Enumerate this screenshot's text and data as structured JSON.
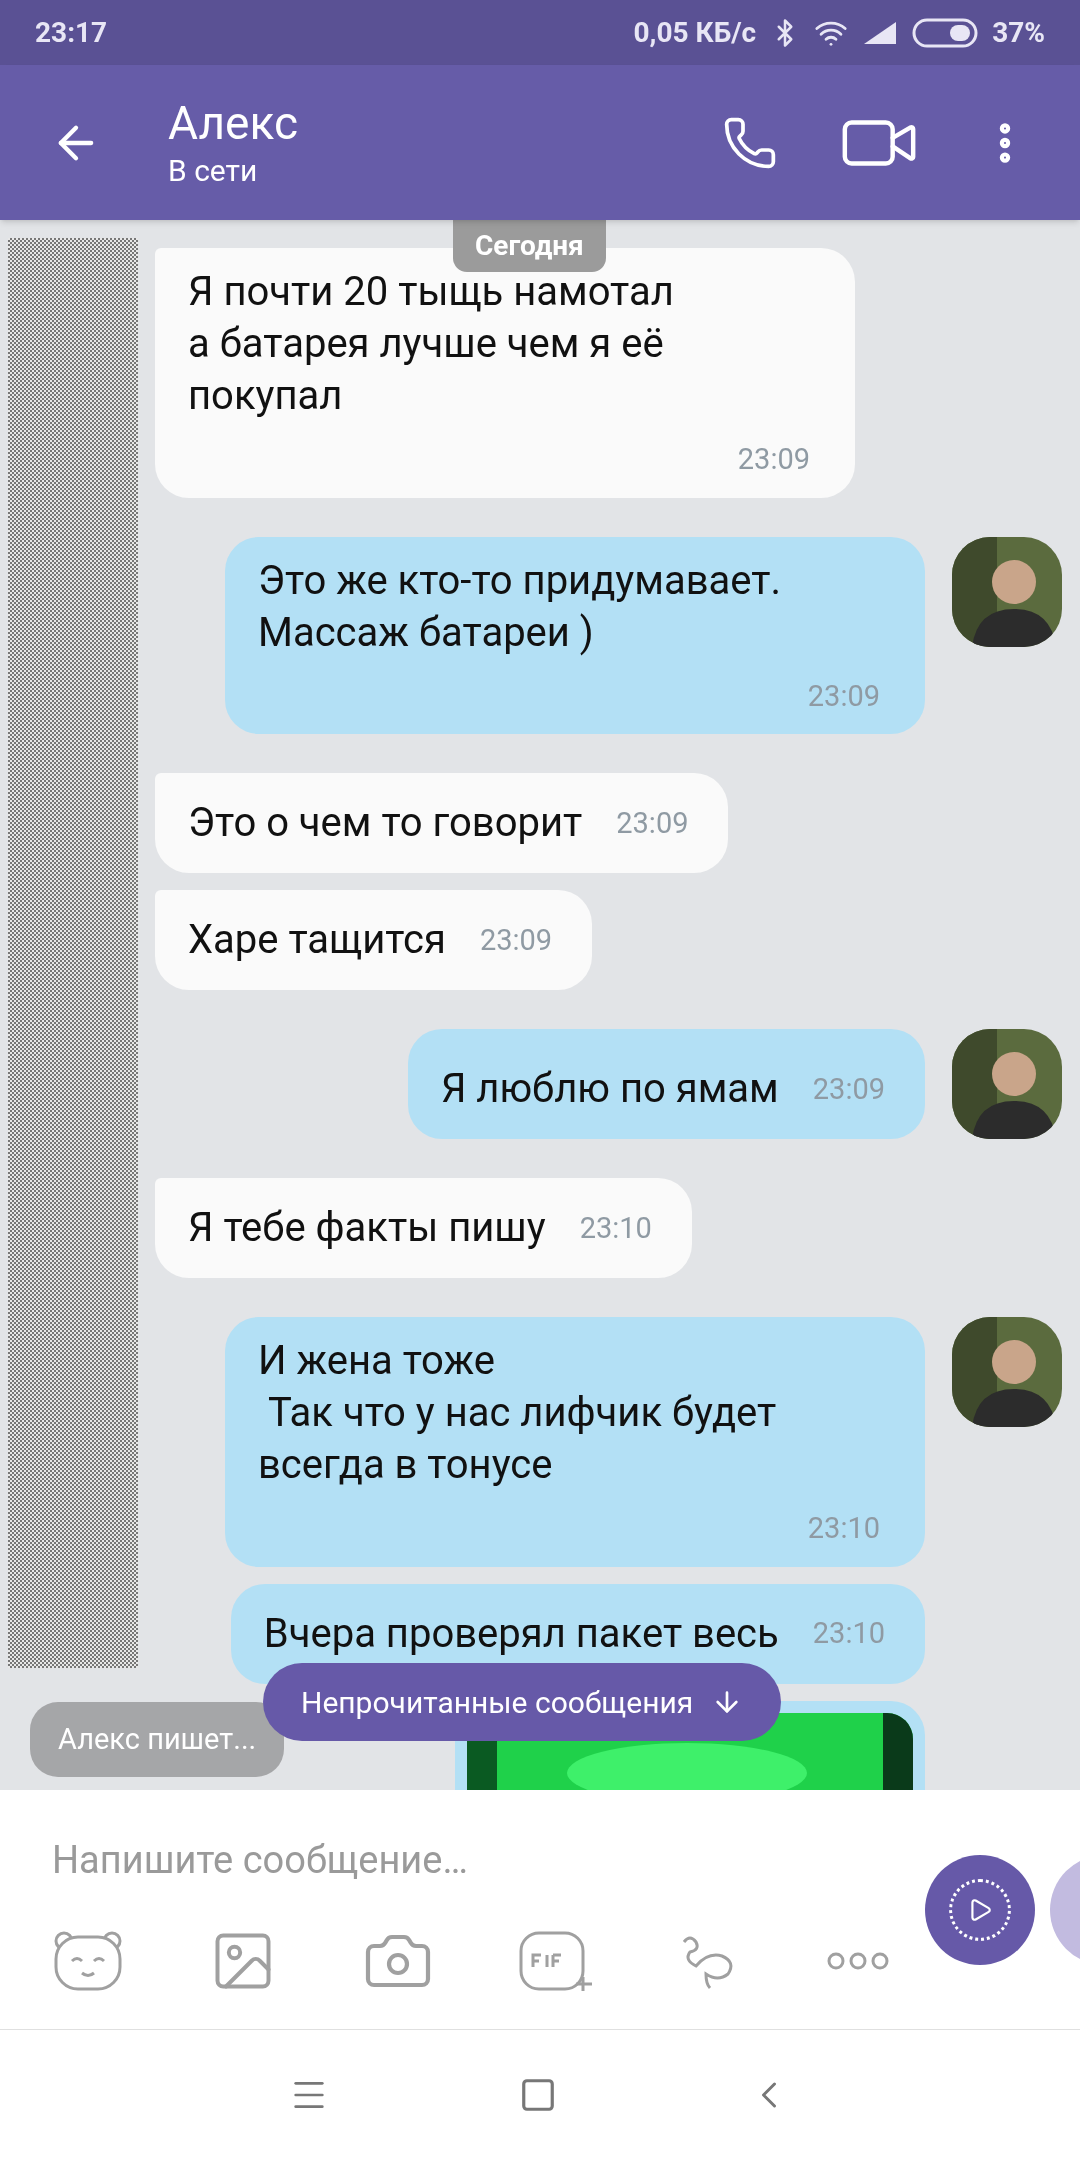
{
  "status_bar": {
    "time": "23:17",
    "network_speed": "0,05 КБ/с",
    "battery": "37%"
  },
  "header": {
    "title": "Алекс",
    "subtitle": "В сети"
  },
  "date_chip": "Сегодня",
  "messages": [
    {
      "kind": "incoming",
      "text": "Я почти 20 тыщь намотал\nа батарея лучше чем я её\nпокупал",
      "time": "23:09"
    },
    {
      "kind": "outgoing",
      "text": "Это же кто-то придумавает.\nМассаж батареи )",
      "time": "23:09",
      "avatar": true
    },
    {
      "kind": "incoming",
      "text": "Это о чем то говорит",
      "time": "23:09"
    },
    {
      "kind": "incoming",
      "text": "Харе тащится",
      "time": "23:09"
    },
    {
      "kind": "outgoing",
      "text": "Я люблю по ямам",
      "time": "23:09",
      "avatar": true
    },
    {
      "kind": "incoming",
      "text": "Я тебе факты пишу",
      "time": "23:10"
    },
    {
      "kind": "outgoing",
      "text": "И жена тоже\n Так что у нас лифчик будет\nвсегда в тонусе",
      "time": "23:10",
      "avatar": true
    },
    {
      "kind": "outgoing",
      "text": "Вчера проверял пакет весь",
      "time": "23:10",
      "avatar": false
    },
    {
      "kind": "outgoing_picture",
      "avatar": false
    }
  ],
  "unread_button": "Непрочитанные сообщения",
  "typing_indicator": "Алекс пишет...",
  "composer": {
    "placeholder": "Напишите сообщение…"
  }
}
